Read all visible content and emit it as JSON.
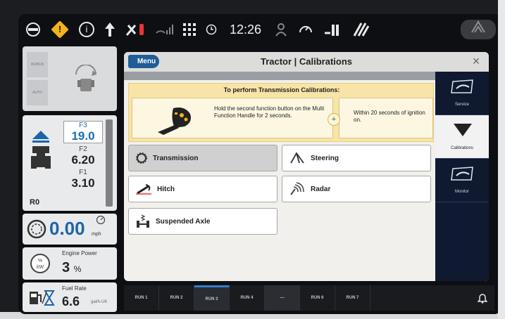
{
  "status_bar": {
    "clock": "12:26",
    "info_glyph": "i",
    "warn_glyph": "!",
    "icons": [
      "gps-antenna-icon",
      "warning-icon",
      "info-icon",
      "up-arrow-icon",
      "tools-icon",
      "signal-icon",
      "grid-icon",
      "clock-icon",
      "person-icon",
      "gauge-icon",
      "implement-icon",
      "field-icon",
      "home-icon"
    ]
  },
  "left_panel": {
    "tab_labels": [
      "iSOBUS",
      "AUTO"
    ],
    "gears": [
      {
        "label": "F3",
        "value": "19.0",
        "selected": true
      },
      {
        "label": "F2",
        "value": "6.20",
        "selected": false
      },
      {
        "label": "F1",
        "value": "3.10",
        "selected": false
      }
    ],
    "reverse_gear": "R0",
    "speed": "0.00",
    "speed_unit": "mph",
    "engine_power_label": "Engine Power",
    "engine_power_value": "3",
    "engine_power_unit": "%",
    "fuel_rate_label": "Fuel Rate",
    "fuel_rate_value": "6.6",
    "fuel_rate_unit": "gal/h-UK"
  },
  "dialog": {
    "menu_label": "Menu",
    "title": "Tractor | Calibrations",
    "close_glyph": "×",
    "notice_title": "To perform Transmission Calibrations:",
    "step1": "Hold the second function button on the Multi Function Handle for 2 seconds.",
    "step2": "Within 20 seconds of ignition on.",
    "plus_glyph": "+",
    "buttons": {
      "transmission": "Transmission",
      "steering": "Steering",
      "hitch": "Hitch",
      "radar": "Radar",
      "suspended_axle": "Suspended Axle"
    }
  },
  "right_nav": {
    "items": [
      {
        "label": "Service",
        "icon": "wrench-card-icon"
      },
      {
        "label": "Calibrations",
        "icon": "down-triangle-icon"
      },
      {
        "label": "Monitor",
        "icon": "monitor-card-icon"
      }
    ]
  },
  "run_bar": {
    "runs": [
      "RUN 1",
      "RUN 2",
      "RUN 3",
      "RUN 4",
      "—",
      "RUN 6",
      "RUN 7"
    ],
    "active_index": 2
  },
  "colors": {
    "accent": "#1f5c99",
    "notice": "#f7e4a6",
    "nav": "#0f1930",
    "speed": "#1c64aa"
  }
}
